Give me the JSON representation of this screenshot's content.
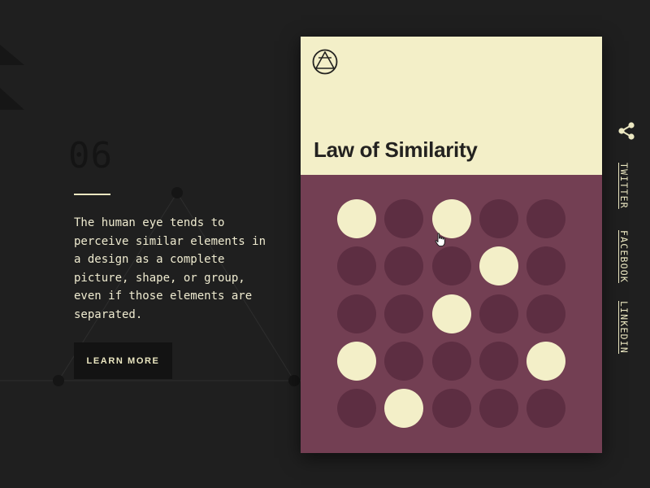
{
  "section_number": "06",
  "description": "The human eye tends to perceive similar elements in a design as a complete picture, shape, or group, even if those elements are separated.",
  "cta_label": "LEARN MORE",
  "card": {
    "title": "Law of Similarity",
    "logo_icon": "circle-triangle-logo-icon",
    "top_color": "#f3efc8",
    "bottom_color": "#733f53",
    "dot_color": "#5d2e42",
    "highlight_color": "#f3efc8",
    "grid_rows": 5,
    "grid_cols": 5,
    "highlighted": [
      [
        0,
        0
      ],
      [
        0,
        2
      ],
      [
        1,
        3
      ],
      [
        2,
        2
      ],
      [
        3,
        0
      ],
      [
        3,
        4
      ],
      [
        4,
        1
      ]
    ]
  },
  "sidebar": {
    "share_icon": "share-icon",
    "links": [
      "TWITTER",
      "FACEBOOK",
      "LINKEDIN"
    ]
  },
  "colors": {
    "background": "#1f1f1f",
    "text": "#efebd0",
    "button_bg": "#131313"
  }
}
